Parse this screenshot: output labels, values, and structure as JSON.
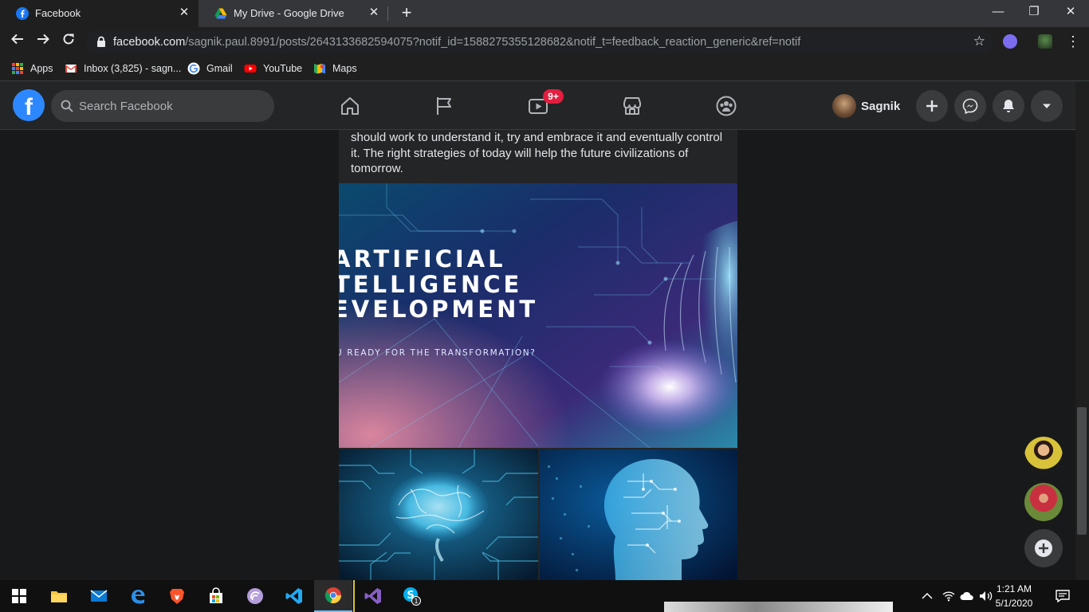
{
  "browser": {
    "tabs": [
      {
        "title": "Facebook",
        "active": true
      },
      {
        "title": "My Drive - Google Drive",
        "active": false
      }
    ],
    "url": {
      "host": "facebook.com",
      "path": "/sagnik.paul.8991/posts/2643133682594075?notif_id=1588275355128682&notif_t=feedback_reaction_generic&ref=notif"
    },
    "bookmarks": [
      {
        "label": "Apps",
        "icon": "apps-grid-icon"
      },
      {
        "label": "Inbox (3,825) - sagn...",
        "icon": "gmail-icon"
      },
      {
        "label": "Gmail",
        "icon": "google-icon"
      },
      {
        "label": "YouTube",
        "icon": "youtube-icon"
      },
      {
        "label": "Maps",
        "icon": "maps-icon"
      }
    ]
  },
  "facebook": {
    "logo": "f",
    "search_placeholder": "Search Facebook",
    "watch_badge": "9+",
    "profile_name": "Sagnik",
    "colors": {
      "brand": "#2d88ff",
      "badge": "#e41e3f",
      "bg": "#18191a",
      "surface": "#242526"
    }
  },
  "post": {
    "text": "should work to understand it, try and embrace it and eventually control it. The right strategies of today will help the future civilizations of tomorrow.",
    "image_text": {
      "line1": "ARTIFICIAL",
      "line2": "TELLIGENCE",
      "line3": "EVELOPMENT",
      "tagline": "U READY FOR THE TRANSFORMATION?"
    }
  },
  "taskbar": {
    "time": "1:21 AM",
    "date": "5/1/2020",
    "skype_badge": "1"
  }
}
